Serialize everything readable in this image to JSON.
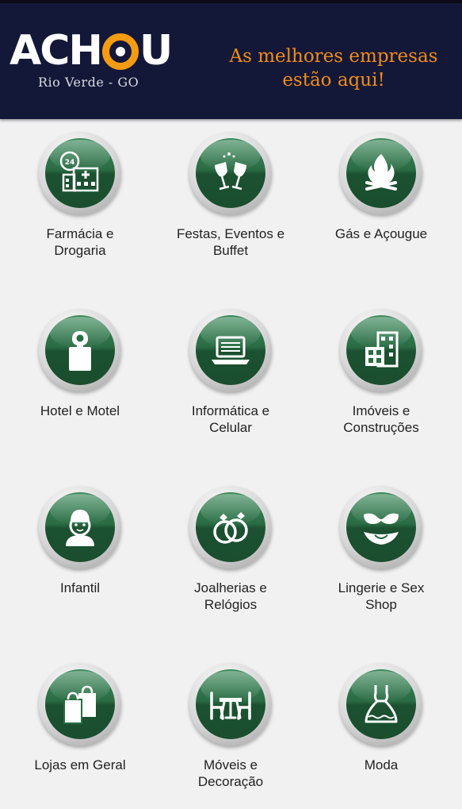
{
  "header": {
    "logo_text_left": "ACH",
    "logo_text_right": "U",
    "logo_subtitle": "Rio Verde - GO",
    "tagline_line1": "As melhores empresas",
    "tagline_line2": "estão aqui!"
  },
  "colors": {
    "header_bg": "#141838",
    "accent_orange": "#f39c12",
    "icon_green": "#1a4e2e",
    "page_bg": "#f1f1f2"
  },
  "categories": [
    {
      "label_line1": "Farmácia e",
      "label_line2": "Drogaria",
      "icon": "pharmacy-icon"
    },
    {
      "label_line1": "Festas, Eventos e",
      "label_line2": "Buffet",
      "icon": "party-glasses-icon"
    },
    {
      "label_line1": "Gás e Açougue",
      "label_line2": "",
      "icon": "flame-icon"
    },
    {
      "label_line1": "Hotel e Motel",
      "label_line2": "",
      "icon": "door-hanger-icon"
    },
    {
      "label_line1": "Informática e",
      "label_line2": "Celular",
      "icon": "laptop-icon"
    },
    {
      "label_line1": "Imóveis e",
      "label_line2": "Construções",
      "icon": "buildings-icon"
    },
    {
      "label_line1": "Infantil",
      "label_line2": "",
      "icon": "child-icon"
    },
    {
      "label_line1": "Joalherias e",
      "label_line2": "Relógios",
      "icon": "rings-icon"
    },
    {
      "label_line1": "Lingerie e Sex",
      "label_line2": "Shop",
      "icon": "lingerie-icon"
    },
    {
      "label_line1": "Lojas em Geral",
      "label_line2": "",
      "icon": "shopping-bags-icon"
    },
    {
      "label_line1": "Móveis e",
      "label_line2": "Decoração",
      "icon": "furniture-icon"
    },
    {
      "label_line1": "Moda",
      "label_line2": "",
      "icon": "dress-icon"
    }
  ]
}
